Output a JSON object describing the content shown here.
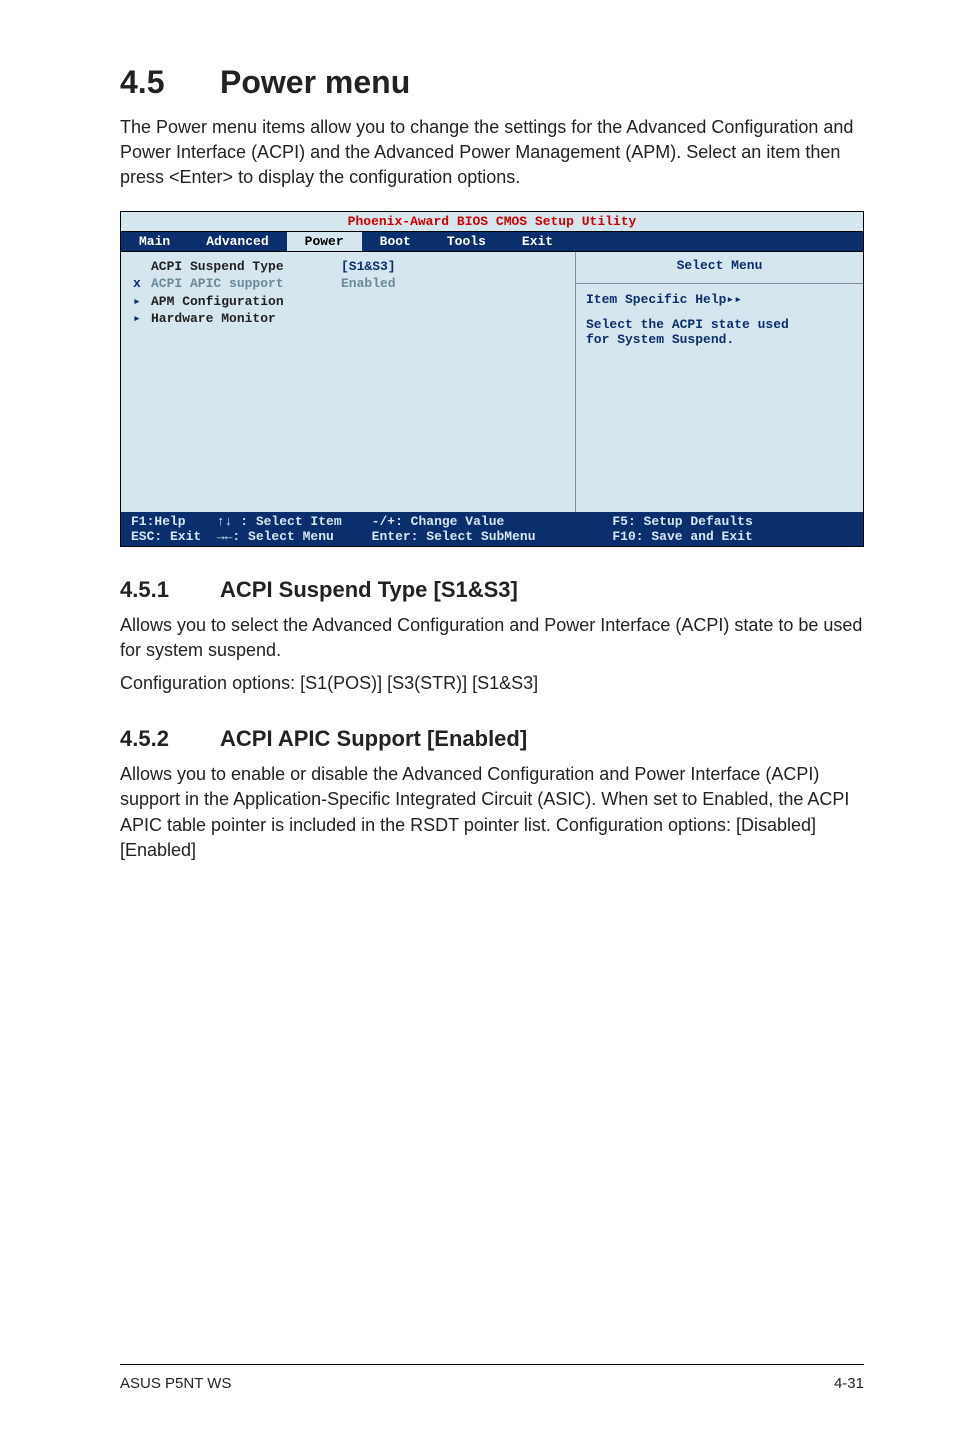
{
  "heading": {
    "num": "4.5",
    "title": "Power menu"
  },
  "intro": "The Power menu items allow you to change the settings for the Advanced Configuration and Power Interface (ACPI) and the Advanced Power Management (APM). Select an item then press <Enter> to display the configuration options.",
  "bios": {
    "title": "Phoenix-Award BIOS CMOS Setup Utility",
    "menubar": [
      "Main",
      "Advanced",
      "Power",
      "Boot",
      "Tools",
      "Exit"
    ],
    "selected_tab": "Power",
    "rows": [
      {
        "gutter": "",
        "label": "ACPI Suspend Type",
        "val": "[S1&S3]",
        "disabled": false
      },
      {
        "gutter": "x",
        "label": "ACPI APIC support",
        "val": "Enabled",
        "disabled": true
      },
      {
        "gutter": "▸",
        "label": "APM Configuration",
        "val": "",
        "disabled": false
      },
      {
        "gutter": "▸",
        "label": "Hardware Monitor",
        "val": "",
        "disabled": false
      }
    ],
    "right": {
      "title": "Select Menu",
      "line1": "Item Specific Help▸▸",
      "line2": "Select the ACPI state used",
      "line3": "for System Suspend."
    },
    "foot": {
      "c1a": "F1:Help    ↑↓ : Select Item",
      "c1b": "ESC: Exit  →←: Select Menu",
      "c2a": "-/+: Change Value",
      "c2b": "Enter: Select SubMenu",
      "c3a": "F5: Setup Defaults",
      "c3b": "F10: Save and Exit"
    }
  },
  "s451": {
    "num": "4.5.1",
    "title": "ACPI Suspend Type [S1&S3]",
    "p1": "Allows you to select the Advanced Configuration and Power Interface (ACPI) state to be used for system suspend.",
    "p2": "Configuration options: [S1(POS)] [S3(STR)] [S1&S3]"
  },
  "s452": {
    "num": "4.5.2",
    "title": "ACPI APIC Support [Enabled]",
    "p1": "Allows you to enable or disable the Advanced Configuration and Power Interface (ACPI) support in the Application-Specific Integrated Circuit (ASIC). When set to Enabled, the ACPI APIC table pointer is included in the RSDT pointer list. Configuration options: [Disabled] [Enabled]"
  },
  "footer": {
    "left": "ASUS P5NT WS",
    "right": "4-31"
  }
}
